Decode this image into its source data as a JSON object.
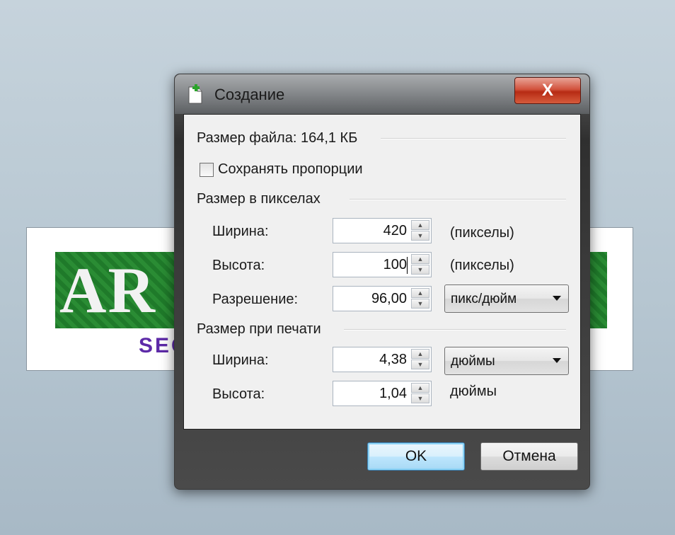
{
  "background": {
    "logo_text": "AR",
    "logo_subtext": "SEC"
  },
  "dialog": {
    "title": "Создание",
    "close_label": "X",
    "file_size": "Размер файла: 164,1 КБ",
    "keep_proportions": {
      "label": "Сохранять пропорции",
      "checked": false
    },
    "pixel_section": {
      "title": "Размер в пикселах",
      "width": {
        "label": "Ширина:",
        "value": "420",
        "unit": "(пикселы)"
      },
      "height": {
        "label": "Высота:",
        "value": "100",
        "unit": "(пикселы)"
      },
      "resolution": {
        "label": "Разрешение:",
        "value": "96,00",
        "unit": "пикс/дюйм"
      }
    },
    "print_section": {
      "title": "Размер при печати",
      "width": {
        "label": "Ширина:",
        "value": "4,38",
        "unit": "дюймы"
      },
      "height": {
        "label": "Высота:",
        "value": "1,04",
        "unit": "дюймы"
      }
    },
    "buttons": {
      "ok": "OK",
      "cancel": "Отмена"
    }
  },
  "colors": {
    "close_button": "#c8391f",
    "default_button_border": "#3c7fb1",
    "logo_green": "#1f7a2a",
    "logo_purple": "#5d2aa8"
  }
}
